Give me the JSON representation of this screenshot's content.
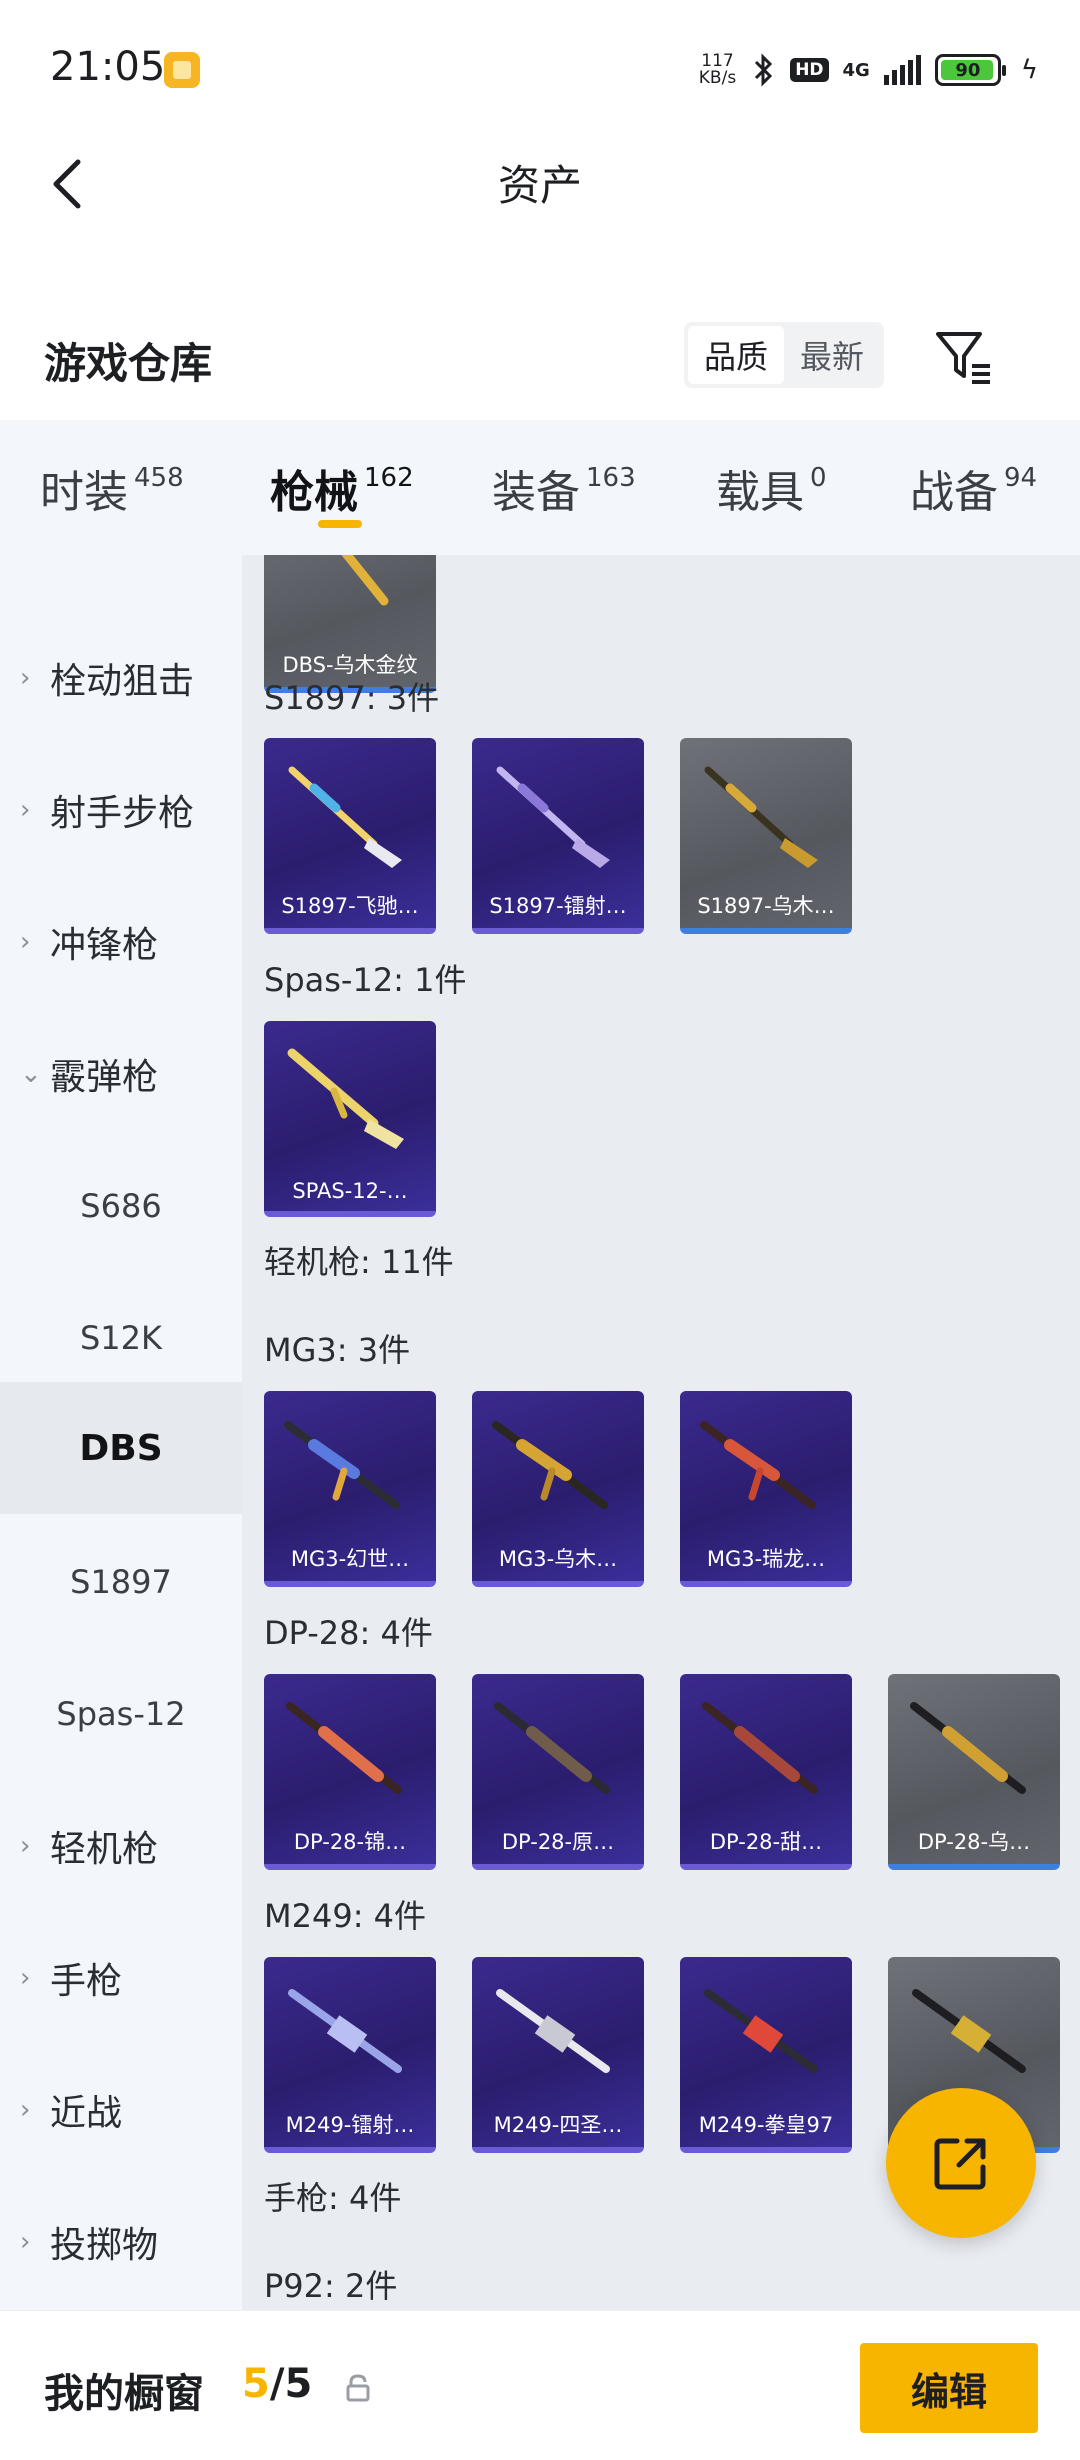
{
  "status_bar": {
    "time": "21:05",
    "net_speed_value": "117",
    "net_speed_unit": "KB/s",
    "hd": "HD",
    "network": "4G",
    "battery": "90"
  },
  "nav": {
    "title": "资产"
  },
  "section": {
    "title": "游戏仓库",
    "sort_options": [
      "品质",
      "最新"
    ],
    "active_sort": "品质"
  },
  "tabs": [
    {
      "label": "时装",
      "count": "458"
    },
    {
      "label": "枪械",
      "count": "162",
      "active": true
    },
    {
      "label": "装备",
      "count": "163"
    },
    {
      "label": "载具",
      "count": "0"
    },
    {
      "label": "战备",
      "count": "94"
    }
  ],
  "sidebar": [
    {
      "label": "栓动狙击",
      "type": "category",
      "expanded": false
    },
    {
      "label": "射手步枪",
      "type": "category",
      "expanded": false
    },
    {
      "label": "冲锋枪",
      "type": "category",
      "expanded": false
    },
    {
      "label": "霰弹枪",
      "type": "category",
      "expanded": true
    },
    {
      "label": "S686",
      "type": "sub"
    },
    {
      "label": "S12K",
      "type": "sub"
    },
    {
      "label": "DBS",
      "type": "sub",
      "selected": true
    },
    {
      "label": "S1897",
      "type": "sub"
    },
    {
      "label": "Spas-12",
      "type": "sub"
    },
    {
      "label": "轻机枪",
      "type": "category",
      "expanded": false
    },
    {
      "label": "手枪",
      "type": "category",
      "expanded": false
    },
    {
      "label": "近战",
      "type": "category",
      "expanded": false
    },
    {
      "label": "投掷物",
      "type": "category",
      "expanded": false
    }
  ],
  "content": {
    "top_partial_card": {
      "name": "DBS-乌木金纹"
    },
    "groups": [
      {
        "title": "S1897: 3件",
        "items": [
          {
            "name": "S1897-飞驰…",
            "rarity": "purple"
          },
          {
            "name": "S1897-镭射…",
            "rarity": "purple"
          },
          {
            "name": "S1897-乌木…",
            "rarity": "grey"
          }
        ]
      },
      {
        "title": "Spas-12: 1件",
        "items": [
          {
            "name": "SPAS-12-…",
            "rarity": "purple"
          }
        ]
      },
      {
        "title": "轻机枪: 11件",
        "items": []
      },
      {
        "title": "MG3: 3件",
        "items": [
          {
            "name": "MG3-幻世…",
            "rarity": "purple"
          },
          {
            "name": "MG3-乌木…",
            "rarity": "purple"
          },
          {
            "name": "MG3-瑞龙…",
            "rarity": "purple"
          }
        ]
      },
      {
        "title": "DP-28: 4件",
        "items": [
          {
            "name": "DP-28-锦…",
            "rarity": "purple"
          },
          {
            "name": "DP-28-原…",
            "rarity": "purple"
          },
          {
            "name": "DP-28-甜…",
            "rarity": "purple"
          },
          {
            "name": "DP-28-乌…",
            "rarity": "grey"
          }
        ]
      },
      {
        "title": "M249: 4件",
        "items": [
          {
            "name": "M249-镭射…",
            "rarity": "purple"
          },
          {
            "name": "M249-四圣…",
            "rarity": "purple"
          },
          {
            "name": "M249-拳皇97",
            "rarity": "purple"
          },
          {
            "name": "…",
            "rarity": "grey"
          }
        ]
      },
      {
        "title": "手枪: 4件",
        "items": []
      },
      {
        "title": "P92: 2件",
        "items": []
      }
    ]
  },
  "bottom_bar": {
    "label": "我的橱窗",
    "current": "5",
    "separator": "/",
    "max": "5",
    "edit_label": "编辑"
  },
  "colors": {
    "accent": "#f7b500",
    "rare_card": "#2f2178",
    "common_card": "#5f6268"
  }
}
